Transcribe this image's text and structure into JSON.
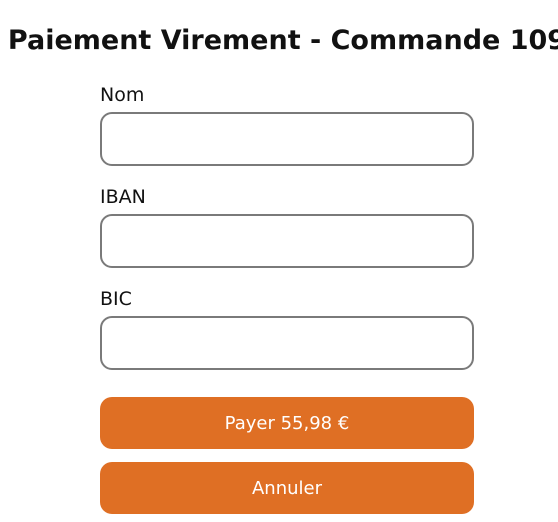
{
  "page": {
    "title": "Paiement Virement - Commande 109"
  },
  "form": {
    "fields": [
      {
        "label": "Nom",
        "value": "",
        "placeholder": ""
      },
      {
        "label": "IBAN",
        "value": "",
        "placeholder": ""
      },
      {
        "label": "BIC",
        "value": "",
        "placeholder": ""
      }
    ],
    "pay_label": "Payer 55,98 €",
    "cancel_label": "Annuler"
  },
  "colors": {
    "accent": "#df6f24",
    "input_border": "#7a7a7a",
    "text": "#111111",
    "button_text": "#ffffff"
  }
}
